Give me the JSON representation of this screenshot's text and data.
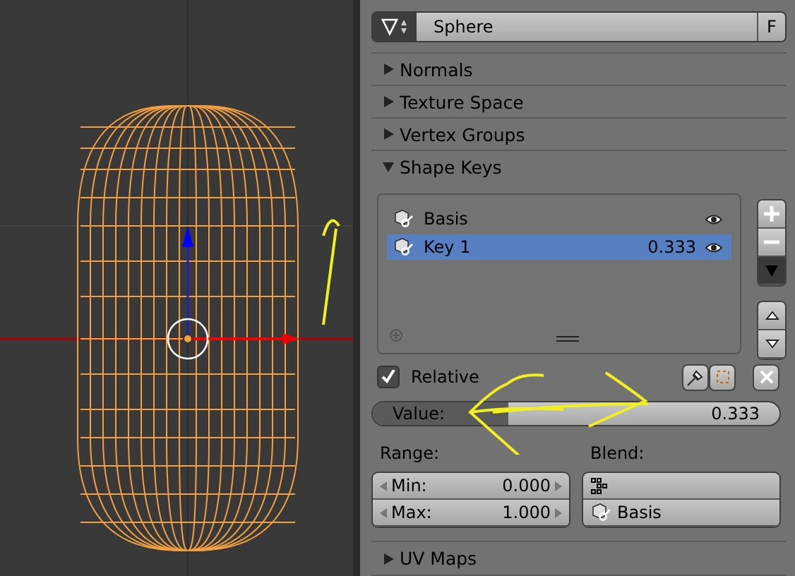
{
  "object_field": {
    "name": "Sphere",
    "fake_user": "F"
  },
  "panels_top": [
    {
      "title": "Normals",
      "expanded": false
    },
    {
      "title": "Texture Space",
      "expanded": false
    },
    {
      "title": "Vertex Groups",
      "expanded": false
    },
    {
      "title": "Shape Keys",
      "expanded": true
    }
  ],
  "shape_keys": {
    "items": [
      {
        "name": "Basis",
        "value": "",
        "selected": false
      },
      {
        "name": "Key 1",
        "value": "0.333",
        "selected": true
      }
    ],
    "relative": {
      "label": "Relative",
      "checked": true
    },
    "value_slider": {
      "label": "Value:",
      "reading": "0.333",
      "level": 0.333
    },
    "range": {
      "label": "Range:",
      "min_label": "Min:",
      "min": "0.000",
      "max_label": "Max:",
      "max": "1.000"
    },
    "blend": {
      "label": "Blend:",
      "relative_key": "Basis"
    }
  },
  "panels_bottom": [
    {
      "title": "UV Maps",
      "expanded": false
    }
  ]
}
